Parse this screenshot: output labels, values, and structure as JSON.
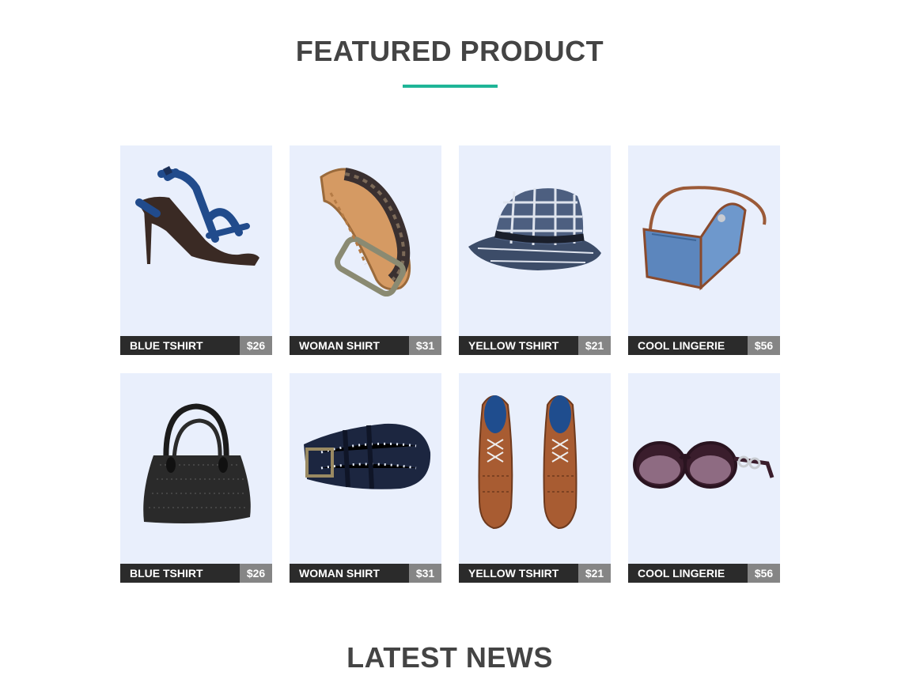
{
  "featured": {
    "title": "FEATURED PRODUCT",
    "products": [
      {
        "name": "BLUE TSHIRT",
        "price": "$26",
        "icon": "sandal-icon"
      },
      {
        "name": "WOMAN SHIRT",
        "price": "$31",
        "icon": "braided-belt-icon"
      },
      {
        "name": "YELLOW TSHIRT",
        "price": "$21",
        "icon": "plaid-hat-icon"
      },
      {
        "name": "COOL LINGERIE",
        "price": "$56",
        "icon": "denim-bag-icon"
      },
      {
        "name": "BLUE TSHIRT",
        "price": "$26",
        "icon": "black-handbag-icon"
      },
      {
        "name": "WOMAN SHIRT",
        "price": "$31",
        "icon": "perforated-belt-icon"
      },
      {
        "name": "YELLOW TSHIRT",
        "price": "$21",
        "icon": "leather-shoes-icon"
      },
      {
        "name": "COOL LINGERIE",
        "price": "$56",
        "icon": "sunglasses-icon"
      }
    ]
  },
  "news": {
    "title": "LATEST NEWS"
  },
  "colors": {
    "accent": "#1fb597",
    "card_bg": "#e9effc",
    "label_bg": "#2b2b2b",
    "price_bg": "#858585",
    "title": "#444444"
  }
}
